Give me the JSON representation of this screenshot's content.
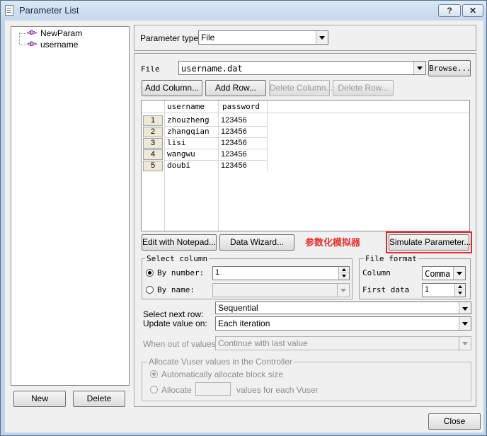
{
  "window": {
    "title": "Parameter List",
    "help_label": "?",
    "close_label": "✕"
  },
  "tree": {
    "items": [
      {
        "icon": "<D>",
        "label": "NewParam"
      },
      {
        "icon": "<D>",
        "label": "username"
      }
    ]
  },
  "left_buttons": {
    "new_label": "New",
    "delete_label": "Delete"
  },
  "param_type": {
    "label": "Parameter type:",
    "value": "File"
  },
  "file": {
    "label": "File",
    "value": "username.dat",
    "browse_label": "Browse..."
  },
  "grid_toolbar": {
    "add_column": "Add Column...",
    "add_row": "Add Row...",
    "delete_column": "Delete Column...",
    "delete_row": "Delete Row..."
  },
  "table": {
    "columns": [
      "username",
      "password"
    ],
    "rows": [
      {
        "num": "1",
        "username": "zhouzheng",
        "password": "123456"
      },
      {
        "num": "2",
        "username": "zhangqian",
        "password": "123456"
      },
      {
        "num": "3",
        "username": "lisi",
        "password": "123456"
      },
      {
        "num": "4",
        "username": "wangwu",
        "password": "123456"
      },
      {
        "num": "5",
        "username": "doubi",
        "password": "123456"
      }
    ]
  },
  "actions": {
    "edit_notepad": "Edit with Notepad...",
    "data_wizard": "Data Wizard...",
    "annotation": "参数化模拟器",
    "simulate": "Simulate Parameter..."
  },
  "select_column": {
    "title": "Select column",
    "by_number_label": "By number:",
    "by_number_value": "1",
    "by_name_label": "By name:",
    "by_name_value": ""
  },
  "file_format": {
    "title": "File format",
    "column_label": "Column",
    "column_value": "Comma",
    "first_data_label": "First data",
    "first_data_value": "1"
  },
  "next_row": {
    "label": "Select next row:",
    "value": "Sequential"
  },
  "update_value": {
    "label": "Update value on:",
    "value": "Each iteration"
  },
  "out_of_values": {
    "label": "When out of values:",
    "value": "Continue with last value"
  },
  "allocate": {
    "title": "Allocate Vuser values in the Controller",
    "auto_label": "Automatically allocate block size",
    "allocate_label": "Allocate",
    "allocate_value": "",
    "suffix_label": "values for each Vuser"
  },
  "footer": {
    "close_label": "Close"
  },
  "colors": {
    "highlight_red": "#e8262b",
    "annotation_red": "#e0322e",
    "icon_purple": "#7a2a9a"
  }
}
